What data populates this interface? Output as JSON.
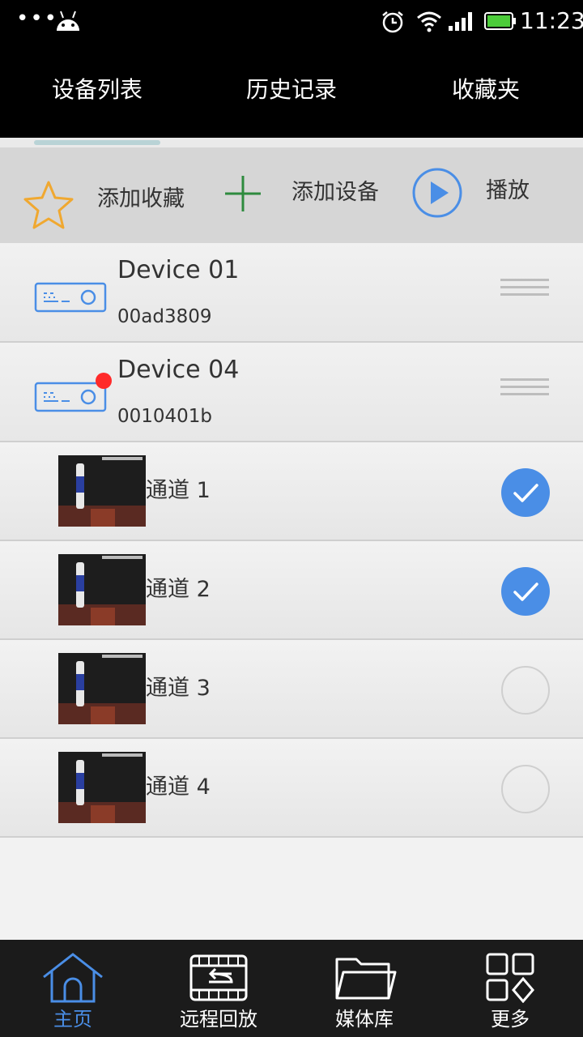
{
  "status_bar": {
    "dots": "•••",
    "time": "11:23",
    "icons": [
      "android-icon",
      "alarm-icon",
      "wifi-icon",
      "signal-icon",
      "battery-icon"
    ]
  },
  "top_tabs": [
    "设备列表",
    "历史记录",
    "收藏夹"
  ],
  "toolbar": {
    "add_favorite": "添加收藏",
    "add_device": "添加设备",
    "play": "播放"
  },
  "devices": [
    {
      "name": "Device 01",
      "id": "00ad3809",
      "has_alert": false
    },
    {
      "name": "Device 04",
      "id": "0010401b",
      "has_alert": true
    }
  ],
  "channels": [
    {
      "label": "通道 1",
      "checked": true
    },
    {
      "label": "通道 2",
      "checked": true
    },
    {
      "label": "通道 3",
      "checked": false
    },
    {
      "label": "通道 4",
      "checked": false
    }
  ],
  "bottom_nav": [
    {
      "label": "主页",
      "active": true
    },
    {
      "label": "远程回放",
      "active": false
    },
    {
      "label": "媒体库",
      "active": false
    },
    {
      "label": "更多",
      "active": false
    }
  ],
  "colors": {
    "accent": "#4a8ee6",
    "alert": "#ff2a2a",
    "star": "#f0a830",
    "plus": "#2e8b3e",
    "battery": "#4ccc3a"
  }
}
